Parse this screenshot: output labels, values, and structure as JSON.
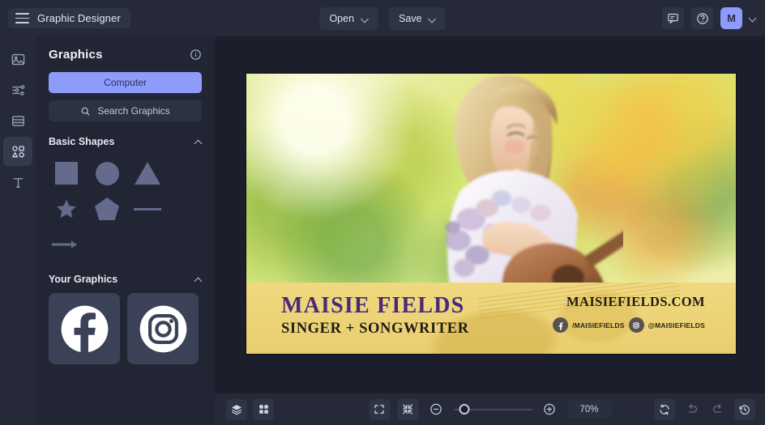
{
  "app": {
    "title": "Graphic Designer",
    "accent_color": "#8d9bfb",
    "topbar_bg": "#262a38",
    "panel_bg": "#222634",
    "stage_bg": "#1c1f2b"
  },
  "topbar": {
    "menu_icon": "hamburger-icon",
    "open_label": "Open",
    "save_label": "Save",
    "comment_icon": "comment-icon",
    "help_icon": "help-circle-icon",
    "avatar_initial": "M",
    "account_caret_icon": "chevron-down-icon"
  },
  "rail": {
    "items": [
      {
        "name": "images",
        "icon": "image-icon",
        "active": false
      },
      {
        "name": "adjustments",
        "icon": "sliders-icon",
        "active": false
      },
      {
        "name": "pages",
        "icon": "layout-icon",
        "active": false
      },
      {
        "name": "graphics",
        "icon": "shapes-icon",
        "active": true
      },
      {
        "name": "text",
        "icon": "text-icon",
        "active": false
      }
    ]
  },
  "panel": {
    "title": "Graphics",
    "info_icon": "info-circle-icon",
    "source_button": "Computer",
    "search_placeholder": "Search Graphics",
    "search_icon": "search-icon",
    "sections": [
      {
        "title": "Basic Shapes",
        "collapse_icon": "chevron-up-icon",
        "shapes": [
          {
            "name": "square",
            "label": "Square"
          },
          {
            "name": "circle",
            "label": "Circle"
          },
          {
            "name": "triangle",
            "label": "Triangle"
          },
          {
            "name": "star",
            "label": "Star"
          },
          {
            "name": "pentagon",
            "label": "Pentagon"
          },
          {
            "name": "line",
            "label": "Line"
          },
          {
            "name": "arrow",
            "label": "Arrow"
          }
        ]
      },
      {
        "title": "Your Graphics",
        "collapse_icon": "chevron-up-icon",
        "thumbnails": [
          {
            "name": "facebook-logo",
            "label": "Facebook"
          },
          {
            "name": "instagram-logo",
            "label": "Instagram"
          }
        ]
      }
    ]
  },
  "canvas": {
    "artwork": {
      "description": "watercolor painting of a blonde woman playing acoustic guitar in a yellow-green wildflower meadow",
      "band_color": "#edd478",
      "brand_name": "MAISIE FIELDS",
      "brand_name_color": "#4a2a78",
      "brand_tagline": "SINGER + SONGWRITER",
      "website": "MAISIEFIELDS.COM",
      "socials": [
        {
          "icon": "facebook-icon",
          "handle": "/MAISIEFIELDS"
        },
        {
          "icon": "instagram-icon",
          "handle": "@MAISIEFIELDS"
        }
      ]
    }
  },
  "bottombar": {
    "layers_icon": "layers-icon",
    "grid_icon": "grid-icon",
    "fit_icon": "fit-to-screen-icon",
    "shrink_icon": "shrink-to-fit-icon",
    "zoom_out_icon": "zoom-out-icon",
    "zoom_in_icon": "zoom-in-icon",
    "zoom_level": "70%",
    "reset_icon": "reset-icon",
    "undo_icon": "undo-icon",
    "redo_icon": "redo-icon",
    "history_icon": "history-icon"
  }
}
